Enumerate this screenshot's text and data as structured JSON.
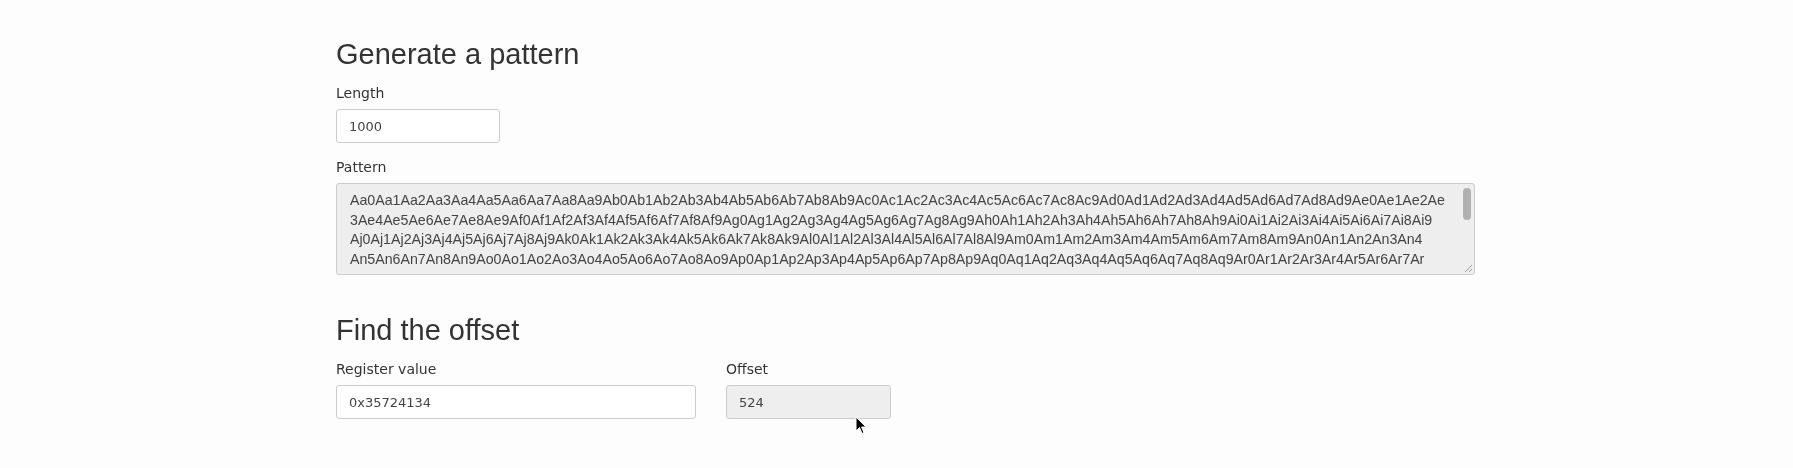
{
  "sections": [
    {
      "kind": "generate",
      "title": "Generate a pattern",
      "length": {
        "label": "Length",
        "value": "1000"
      },
      "pattern": {
        "label": "Pattern",
        "lines": [
          "Aa0Aa1Aa2Aa3Aa4Aa5Aa6Aa7Aa8Aa9Ab0Ab1Ab2Ab3Ab4Ab5Ab6Ab7Ab8Ab9Ac0Ac1Ac2Ac3Ac4Ac5Ac6Ac7Ac8Ac9Ad0Ad1Ad2Ad3Ad4Ad5Ad6Ad7Ad8Ad9Ae0Ae1Ae2Ae",
          "3Ae4Ae5Ae6Ae7Ae8Ae9Af0Af1Af2Af3Af4Af5Af6Af7Af8Af9Ag0Ag1Ag2Ag3Ag4Ag5Ag6Ag7Ag8Ag9Ah0Ah1Ah2Ah3Ah4Ah5Ah6Ah7Ah8Ah9Ai0Ai1Ai2Ai3Ai4Ai5Ai6Ai7Ai8Ai9",
          "Aj0Aj1Aj2Aj3Aj4Aj5Aj6Aj7Aj8Aj9Ak0Ak1Ak2Ak3Ak4Ak5Ak6Ak7Ak8Ak9Al0Al1Al2Al3Al4Al5Al6Al7Al8Al9Am0Am1Am2Am3Am4Am5Am6Am7Am8Am9An0An1An2An3An4",
          "An5An6An7An8An9Ao0Ao1Ao2Ao3Ao4Ao5Ao6Ao7Ao8Ao9Ap0Ap1Ap2Ap3Ap4Ap5Ap6Ap7Ap8Ap9Aq0Aq1Aq2Aq3Aq4Aq5Aq6Aq7Aq8Aq9Ar0Ar1Ar2Ar3Ar4Ar5Ar6Ar7Ar"
        ]
      }
    },
    {
      "kind": "offset",
      "title": "Find the offset",
      "register": {
        "label": "Register value",
        "value": "0x35724134"
      },
      "offset": {
        "label": "Offset",
        "value": "524"
      }
    }
  ]
}
